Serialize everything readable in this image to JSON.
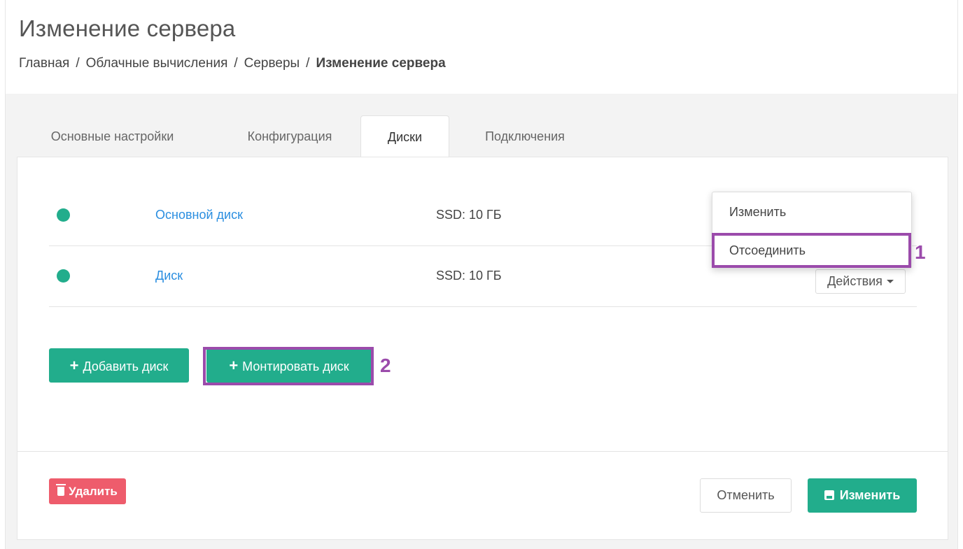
{
  "header": {
    "title": "Изменение сервера",
    "breadcrumb": [
      "Главная",
      "Облачные вычисления",
      "Серверы",
      "Изменение сервера"
    ]
  },
  "tabs": [
    {
      "label": "Основные настройки",
      "active": false
    },
    {
      "label": "Конфигурация",
      "active": false
    },
    {
      "label": "Диски",
      "active": true
    },
    {
      "label": "Подключения",
      "active": false
    }
  ],
  "disks": [
    {
      "name": "Основной диск",
      "size": "SSD: 10 ГБ",
      "status_color": "#22ad8c"
    },
    {
      "name": "Диск",
      "size": "SSD: 10 ГБ",
      "status_color": "#22ad8c"
    }
  ],
  "actions": {
    "label": "Действия"
  },
  "dropdown": {
    "items": [
      "Изменить",
      "Отсоединить"
    ]
  },
  "buttons": {
    "add_disk": "Добавить диск",
    "mount_disk": "Монтировать диск",
    "delete": "Удалить",
    "cancel": "Отменить",
    "save": "Изменить"
  },
  "annotations": {
    "one": "1",
    "two": "2"
  },
  "colors": {
    "accent": "#22ad8c",
    "danger": "#ee5c6c",
    "link": "#2a8ee0",
    "highlight": "#9b4bab"
  }
}
